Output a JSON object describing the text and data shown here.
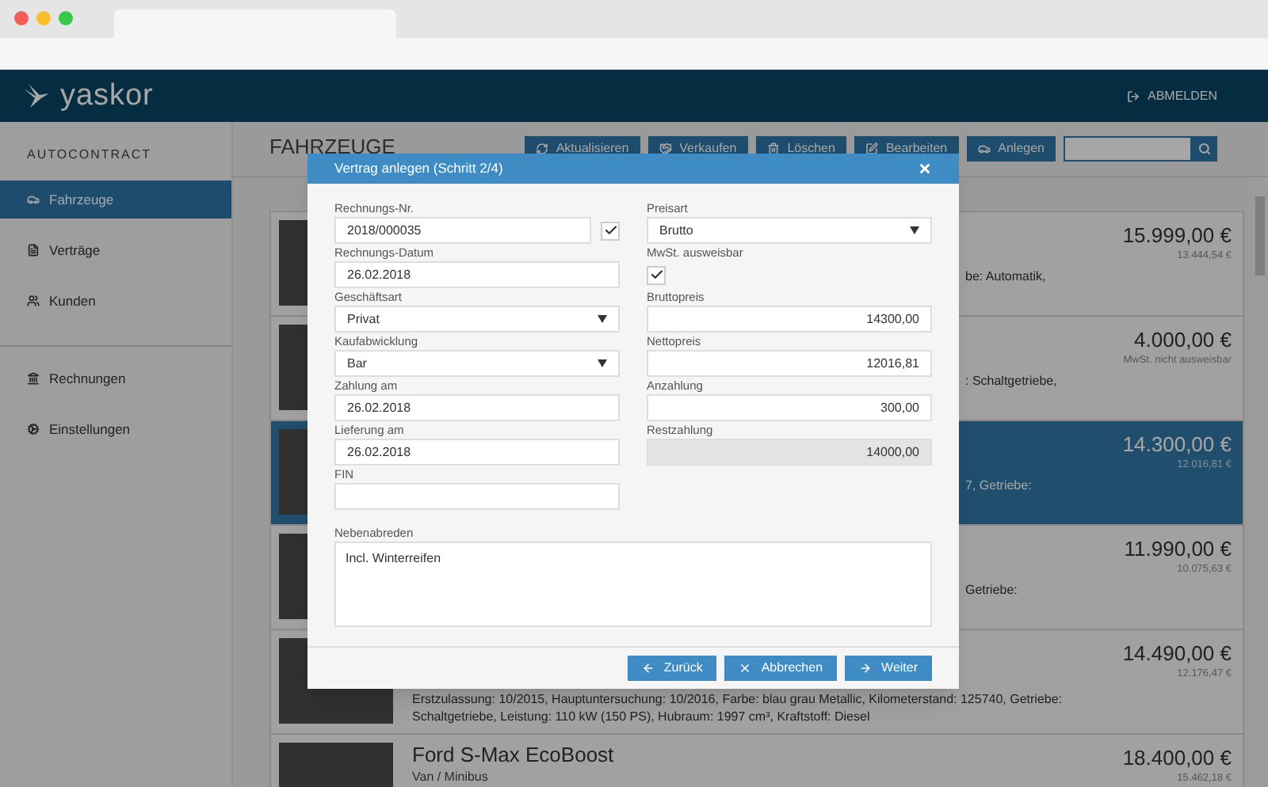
{
  "header": {
    "logo": "yaskor",
    "logout": "ABMELDEN"
  },
  "sidebar": {
    "title": "AUTOCONTRACT",
    "groups": [
      [
        {
          "label": "Fahrzeuge",
          "selected": true
        },
        {
          "label": "Verträge",
          "selected": false
        },
        {
          "label": "Kunden",
          "selected": false
        }
      ],
      [
        {
          "label": "Rechnungen",
          "selected": false
        },
        {
          "label": "Einstellungen",
          "selected": false
        }
      ]
    ]
  },
  "page": {
    "title": "FAHRZEUGE",
    "toolbar": [
      {
        "label": "Aktualisieren"
      },
      {
        "label": "Verkaufen"
      },
      {
        "label": "Löschen"
      },
      {
        "label": "Bearbeiten"
      },
      {
        "label": "Anlegen"
      }
    ]
  },
  "vehicles": [
    {
      "kind": "partial",
      "lines": [
        "be: Automatik,"
      ],
      "price": "15.999,00 €",
      "net_price": "13.444,54 €",
      "selected": false
    },
    {
      "kind": "partial",
      "lines": [
        ": Schaltgetriebe,"
      ],
      "price": "4.000,00 €",
      "net_price": "MwSt. nicht ausweisbar",
      "selected": false
    },
    {
      "kind": "partial",
      "lines": [
        "7, Getriebe:"
      ],
      "price": "14.300,00 €",
      "net_price": "12.016,81 €",
      "selected": true
    },
    {
      "kind": "partial",
      "lines": [
        "Getriebe:"
      ],
      "price": "11.990,00 €",
      "net_price": "10.075,63 €",
      "selected": false
    },
    {
      "kind": "full",
      "lines": [
        "Erstzulassung: 10/2015, Hauptuntersuchung: 10/2016, Farbe: blau grau Metallic, Kilometerstand: 125740, Getriebe:",
        "Schaltgetriebe, Leistung: 110 kW (150 PS), Hubraum: 1997 cm³, Kraftstoff: Diesel"
      ],
      "price": "14.490,00 €",
      "net_price": "12.176,47 €",
      "selected": false
    },
    {
      "kind": "full",
      "title": "Ford S-Max EcoBoost",
      "subtitle": "Van / Minibus",
      "price": "18.400,00 €",
      "net_price": "15.462,18 €",
      "selected": false
    }
  ],
  "dialog": {
    "title": "Vertrag anlegen (Schritt 2/4)",
    "columns": [
      [
        {
          "label": "Rechnungs-Nr.",
          "kind": "text_check",
          "value": "2018/000035",
          "checked": true
        },
        {
          "label": "Rechnungs-Datum",
          "kind": "text",
          "value": "26.02.2018"
        },
        {
          "label": "Geschäftsart",
          "kind": "select",
          "value": "Privat"
        },
        {
          "label": "Kaufabwicklung",
          "kind": "select",
          "value": "Bar"
        },
        {
          "label": "Zahlung am",
          "kind": "text",
          "value": "26.02.2018"
        },
        {
          "label": "Lieferung am",
          "kind": "text",
          "value": "26.02.2018"
        },
        {
          "label": "FIN",
          "kind": "text"
        }
      ],
      [
        {
          "label": "Preisart",
          "kind": "select",
          "value": "Brutto"
        },
        {
          "label": "MwSt. ausweisbar",
          "kind": "checkbox",
          "checked": true
        },
        {
          "label": "Bruttopreis",
          "kind": "number",
          "value": "14300,00"
        },
        {
          "label": "Nettopreis",
          "kind": "number",
          "value": "12016,81"
        },
        {
          "label": "Anzahlung",
          "kind": "number",
          "value": "300,00"
        },
        {
          "label": "Restzahlung",
          "kind": "number",
          "value": "14000,00",
          "disabled": true
        }
      ]
    ],
    "notes": {
      "label": "Nebenabreden",
      "value": "Incl. Winterreifen"
    },
    "buttons": [
      {
        "label": "Zurück"
      },
      {
        "label": "Abbrechen"
      },
      {
        "label": "Weiter"
      }
    ]
  }
}
